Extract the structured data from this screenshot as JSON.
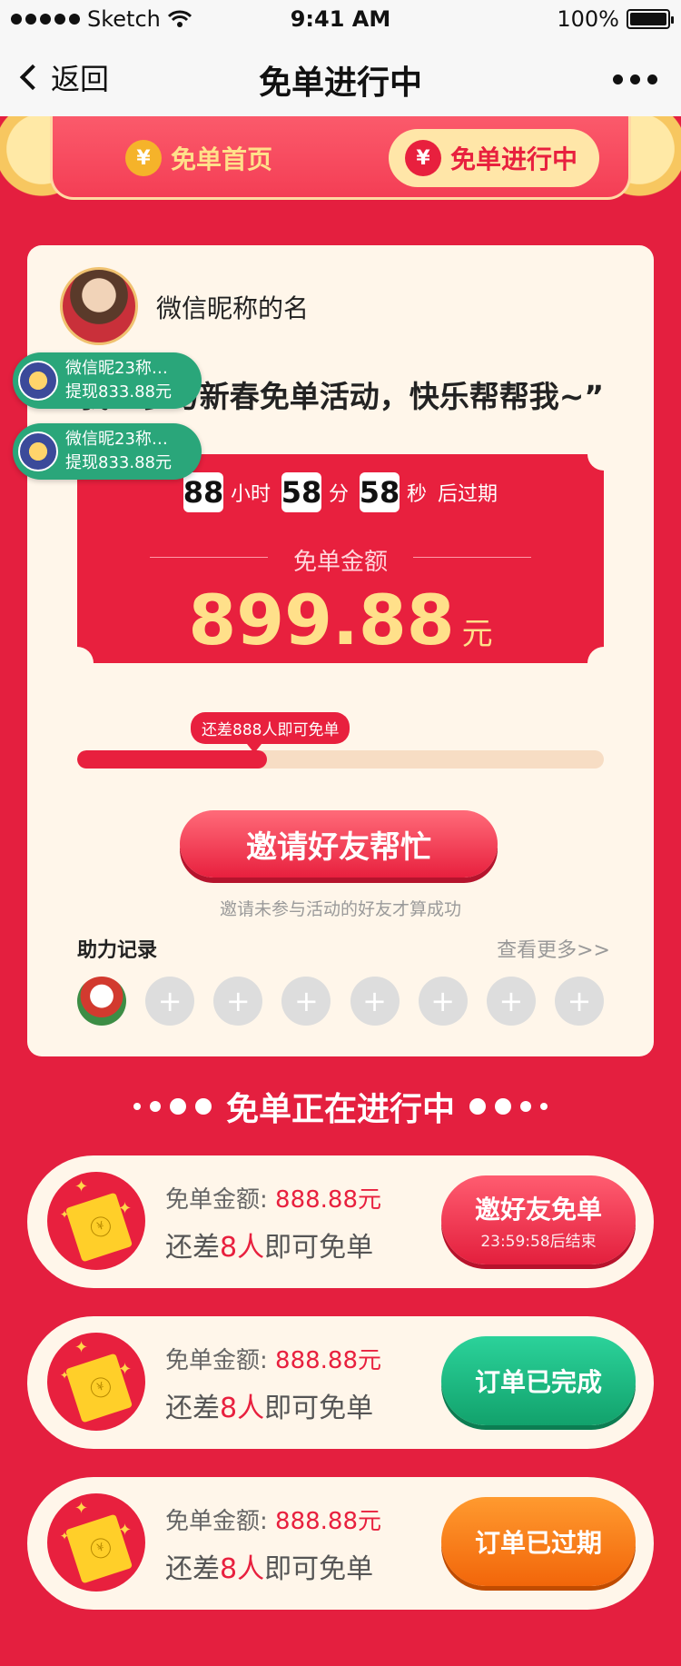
{
  "status_bar": {
    "carrier": "Sketch",
    "time": "9:41 AM",
    "battery": "100%"
  },
  "nav": {
    "back_label": "返回",
    "title": "免单进行中"
  },
  "tabs": [
    {
      "label": "免单首页"
    },
    {
      "label": "免单进行中"
    }
  ],
  "user": {
    "nickname": "微信昵称的名"
  },
  "quote": "“我正参与新春免单活动，快乐帮帮我~”",
  "toasts": [
    {
      "name": "微信昵23称…",
      "text": "提现833.88元"
    },
    {
      "name": "微信昵23称…",
      "text": "提现833.88元"
    }
  ],
  "countdown": {
    "hours": "88",
    "h_unit": "小时",
    "minutes": "58",
    "m_unit": "分",
    "seconds": "58",
    "s_unit": "秒",
    "suffix": "后过期"
  },
  "free_amount": {
    "label": "免单金额",
    "value": "899.88",
    "unit": "元"
  },
  "progress": {
    "tip": "还差888人即可免单",
    "fraction": 0.36
  },
  "invite": {
    "button_label": "邀请好友帮忙",
    "hint": "邀请未参与活动的好友才算成功"
  },
  "records": {
    "title": "助力记录",
    "more_label": "查看更多>>",
    "plus": "+"
  },
  "section_title": "免单正在进行中",
  "orders": [
    {
      "amount_label": "免单金额: ",
      "amount": "888.88元",
      "need_prefix": "还差",
      "need_count": "8人",
      "need_suffix": "即可免单",
      "button_label": "邀好友免单",
      "button_sub": "23:59:58后结束"
    },
    {
      "amount_label": "免单金额: ",
      "amount": "888.88元",
      "need_prefix": "还差",
      "need_count": "8人",
      "need_suffix": "即可免单",
      "button_label": "订单已完成"
    },
    {
      "amount_label": "免单金额: ",
      "amount": "888.88元",
      "need_prefix": "还差",
      "need_count": "8人",
      "need_suffix": "即可免单",
      "button_label": "订单已过期"
    }
  ],
  "colors": {
    "brand_red": "#e8203e",
    "cream": "#fff6ea",
    "gold": "#ffe08a",
    "green": "#12a26c",
    "orange": "#f2660a"
  }
}
